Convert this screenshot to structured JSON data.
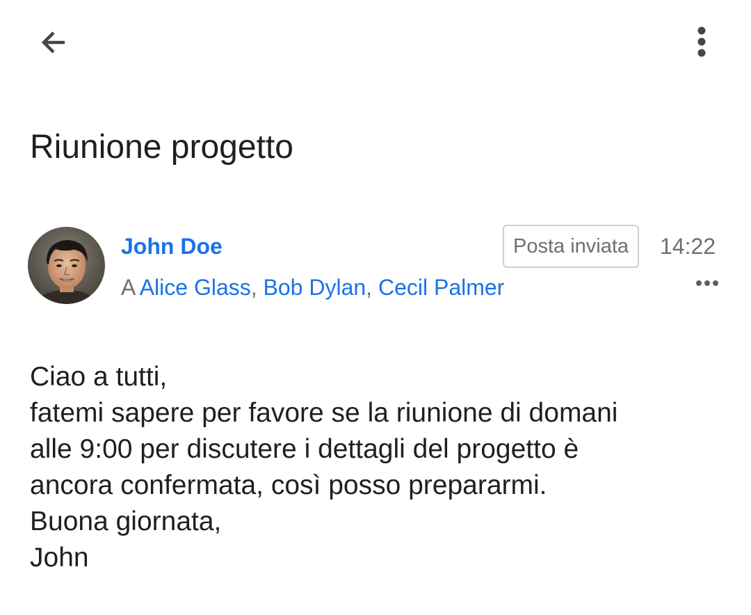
{
  "toolbar": {
    "back_icon": "arrow-left-icon",
    "more_icon": "more-vertical-icon"
  },
  "email": {
    "subject": "Riunione progetto",
    "sender": {
      "name": "John Doe",
      "avatar_icon": "user-photo"
    },
    "recipients": {
      "prefix": "A",
      "names": [
        "Alice Glass",
        "Bob Dylan",
        "Cecil Palmer"
      ],
      "separator": ","
    },
    "folder_badge": "Posta inviata",
    "time": "14:22",
    "details_icon": "more-horizontal-icon",
    "body_lines": [
      "Ciao a tutti,",
      "fatemi sapere per favore se la riunione di domani",
      "alle 9:00 per discutere i dettagli del progetto è",
      "ancora confermata, così posso prepararmi.",
      "Buona giornata,",
      "John"
    ]
  },
  "colors": {
    "link": "#1a73e8",
    "text": "#1f1f1f",
    "muted": "#6f6f6f",
    "badge_border": "#cfcfcf"
  }
}
